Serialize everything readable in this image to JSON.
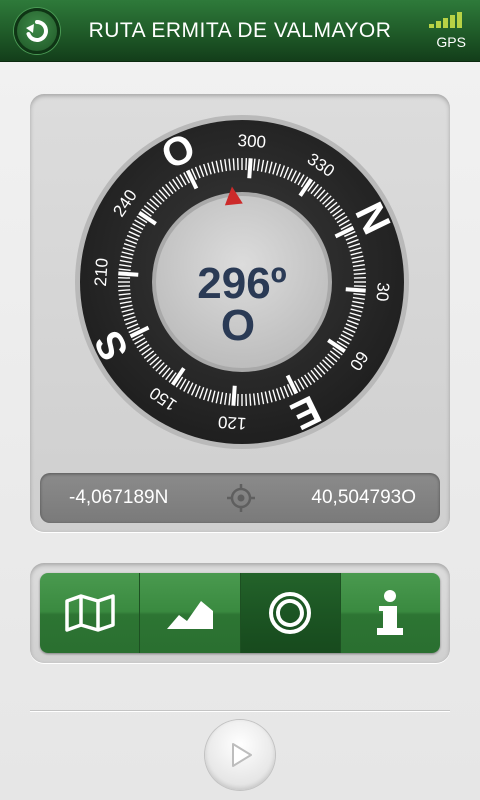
{
  "header": {
    "title": "RUTA ERMITA DE VALMAYOR",
    "gps_label": "GPS",
    "back_icon": "back-arrow-icon"
  },
  "compass": {
    "heading": "296º",
    "heading_direction": "O",
    "cardinals": {
      "north": "N",
      "east": "E",
      "south": "S",
      "west": "O"
    },
    "degree_labels": [
      "30",
      "60",
      "120",
      "150",
      "210",
      "240",
      "300",
      "330"
    ],
    "needle_color": "#cc2a2a"
  },
  "coordinates": {
    "latitude": "-4,067189N",
    "longitude": "40,504793O"
  },
  "tabs": [
    {
      "icon": "map-icon"
    },
    {
      "icon": "elevation-profile-icon"
    },
    {
      "icon": "compass-icon",
      "active": true
    },
    {
      "icon": "info-icon"
    }
  ],
  "controls": {
    "play_icon": "play-icon"
  },
  "colors": {
    "header_green": "#1f5a28",
    "tab_green": "#3a8a40",
    "tab_active": "#1c5523",
    "compass_ring": "#2d2d2d",
    "heading_text": "#2a3a55",
    "gps_bars": "#b7d245"
  }
}
